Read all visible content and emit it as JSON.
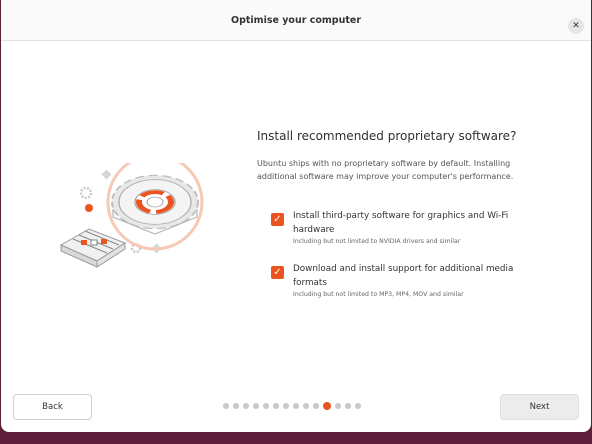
{
  "window": {
    "title": "Optimise your computer",
    "close_glyph": "✕"
  },
  "content": {
    "heading": "Install recommended proprietary software?",
    "description": "Ubuntu ships with no proprietary software by default. Installing additional software may improve your computer's performance.",
    "options": [
      {
        "label": "Install third-party software for graphics and Wi-Fi hardware",
        "hint": "Including but not limited to NVIDIA drivers and similar",
        "checked": true
      },
      {
        "label": "Download and install support for additional media formats",
        "hint": "Including but not limited to MP3, MP4, MOV and similar",
        "checked": true
      }
    ]
  },
  "footer": {
    "back_label": "Back",
    "next_label": "Next",
    "page_count": 14,
    "current_page": 11
  },
  "icons": {
    "checkbox": "check-icon",
    "close": "close-icon",
    "illustration": "gear-settings-illustration"
  },
  "colors": {
    "accent": "#e95420",
    "desktop_background": "#5e1f3b"
  }
}
